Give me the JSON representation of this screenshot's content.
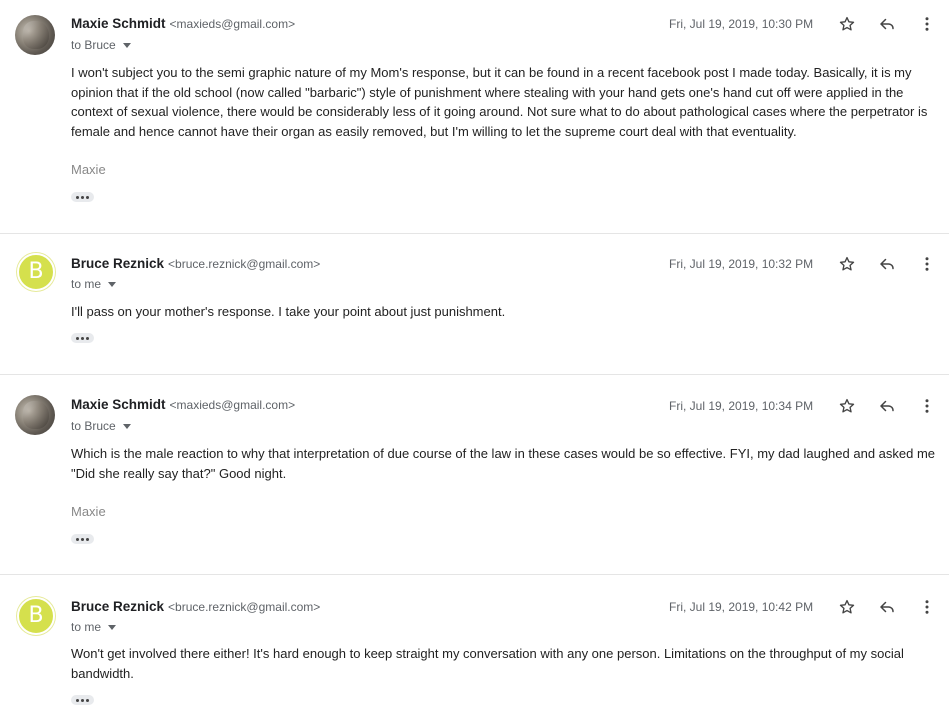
{
  "messages": [
    {
      "sender_name": "Maxie Schmidt",
      "sender_email": "<maxieds@gmail.com>",
      "to": "to Bruce",
      "date": "Fri, Jul 19, 2019, 10:30 PM",
      "avatar": "photo",
      "body": [
        "I won't subject you to the semi graphic nature of my Mom's response, but it can be found in a recent facebook post I made today. Basically, it is my opinion that if the old school (now called \"barbaric\") style of punishment where stealing with your hand gets one's hand cut off were applied in the context of sexual violence, there would be considerably less of it going around. Not sure what to do about pathological cases where the perpetrator is female and hence cannot have their organ as easily removed, but I'm willing to let the supreme court deal with that eventuality."
      ],
      "signature": "Maxie"
    },
    {
      "sender_name": "Bruce Reznick",
      "sender_email": "<bruce.reznick@gmail.com>",
      "to": "to me",
      "date": "Fri, Jul 19, 2019, 10:32 PM",
      "avatar": "letter",
      "avatar_letter": "B",
      "body": [
        "I'll pass on your mother's response. I take your point about just punishment."
      ],
      "signature": ""
    },
    {
      "sender_name": "Maxie Schmidt",
      "sender_email": "<maxieds@gmail.com>",
      "to": "to Bruce",
      "date": "Fri, Jul 19, 2019, 10:34 PM",
      "avatar": "photo",
      "body": [
        "Which is the male reaction to why that interpretation of due course of the law in these cases would be so effective. FYI, my dad laughed and asked me \"Did she really say that?\" Good night."
      ],
      "signature": "Maxie"
    },
    {
      "sender_name": "Bruce Reznick",
      "sender_email": "<bruce.reznick@gmail.com>",
      "to": "to me",
      "date": "Fri, Jul 19, 2019, 10:42 PM",
      "avatar": "letter",
      "avatar_letter": "B",
      "body": [
        "Won't get involved there either! It's hard enough to keep straight my conversation with any one person. Limitations on the throughput of my social bandwidth."
      ],
      "signature": ""
    }
  ],
  "icons": {
    "star": "star-icon",
    "reply": "reply-icon",
    "more": "more-vert-icon",
    "expand": "show-trimmed-content-icon"
  },
  "colors": {
    "avatar_letter_bg": "#d5e04d",
    "secondary_text": "#5f6368",
    "signature_text": "#888888"
  }
}
